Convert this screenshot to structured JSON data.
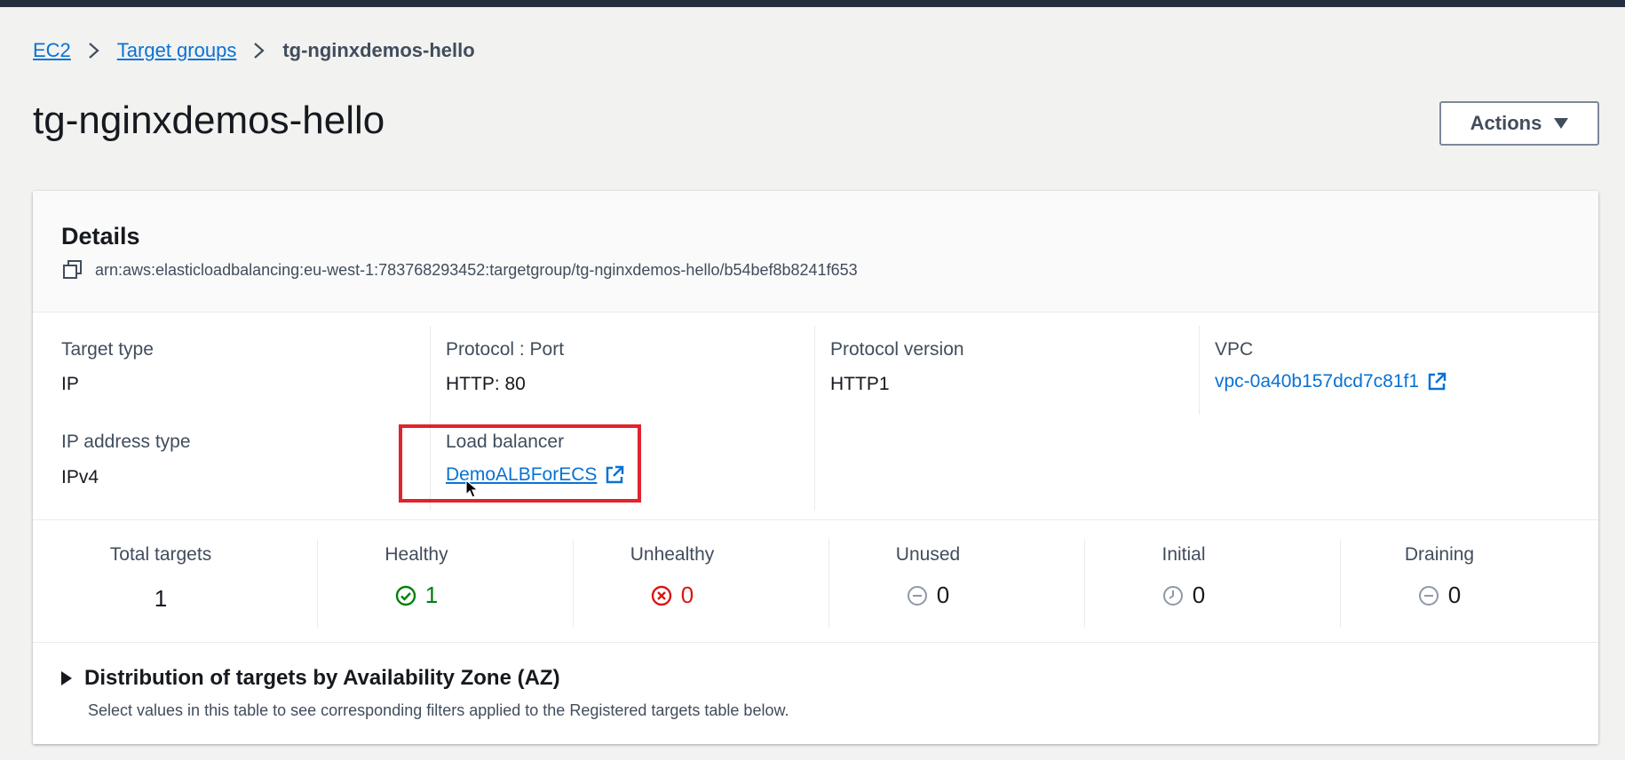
{
  "breadcrumb": {
    "items": [
      {
        "label": "EC2"
      },
      {
        "label": "Target groups"
      }
    ],
    "current": "tg-nginxdemos-hello"
  },
  "page": {
    "title": "tg-nginxdemos-hello",
    "actions_label": "Actions"
  },
  "details": {
    "title": "Details",
    "arn": "arn:aws:elasticloadbalancing:eu-west-1:783768293452:targetgroup/tg-nginxdemos-hello/b54bef8b8241f653",
    "fields": {
      "target_type": {
        "label": "Target type",
        "value": "IP"
      },
      "protocol_port": {
        "label": "Protocol : Port",
        "value": "HTTP: 80"
      },
      "protocol_version": {
        "label": "Protocol version",
        "value": "HTTP1"
      },
      "vpc": {
        "label": "VPC",
        "value": "vpc-0a40b157dcd7c81f1"
      },
      "ip_address_type": {
        "label": "IP address type",
        "value": "IPv4"
      },
      "load_balancer": {
        "label": "Load balancer",
        "value": "DemoALBForECS"
      }
    }
  },
  "targets": {
    "total": {
      "label": "Total targets",
      "value": "1"
    },
    "healthy": {
      "label": "Healthy",
      "value": "1"
    },
    "unhealthy": {
      "label": "Unhealthy",
      "value": "0"
    },
    "unused": {
      "label": "Unused",
      "value": "0"
    },
    "initial": {
      "label": "Initial",
      "value": "0"
    },
    "draining": {
      "label": "Draining",
      "value": "0"
    }
  },
  "az_distribution": {
    "title": "Distribution of targets by Availability Zone (AZ)",
    "description": "Select values in this table to see corresponding filters applied to the Registered targets table below."
  },
  "colors": {
    "link": "#0972d3",
    "healthy": "#037f0c",
    "unhealthy": "#d91515",
    "neutral": "#687078",
    "highlight": "#e0242b",
    "topbar": "#232f3e"
  },
  "icons": {
    "breadcrumb_separator": "chevron-right-icon",
    "copy": "copy-icon",
    "external_link": "external-link-icon",
    "healthy": "check-circle-icon",
    "unhealthy": "x-circle-icon",
    "unused": "minus-circle-icon",
    "initial": "clock-icon",
    "draining": "minus-circle-icon",
    "expand": "caret-right-icon",
    "actions_dropdown": "caret-down-icon"
  }
}
